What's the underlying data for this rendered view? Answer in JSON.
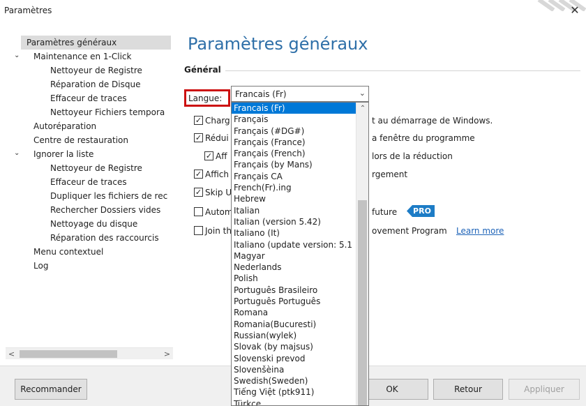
{
  "window": {
    "title": "Paramètres",
    "close_glyph": "✕"
  },
  "sidebar": {
    "items": [
      {
        "label": "Paramètres généraux",
        "selected": true
      },
      {
        "label": "Maintenance en 1-Click",
        "toggle": "expanded"
      },
      {
        "label": "Nettoyeur de Registre"
      },
      {
        "label": "Réparation de Disque"
      },
      {
        "label": "Effaceur de traces"
      },
      {
        "label": "Nettoyeur Fichiers tempora"
      },
      {
        "label": "Autoréparation"
      },
      {
        "label": "Centre de restauration"
      },
      {
        "label": "Ignorer la liste",
        "toggle": "expanded"
      },
      {
        "label": "Nettoyeur de Registre"
      },
      {
        "label": "Effaceur de traces"
      },
      {
        "label": "Dupliquer les fichiers de rec"
      },
      {
        "label": "Rechercher Dossiers vides"
      },
      {
        "label": "Nettoyage du disque"
      },
      {
        "label": "Réparation des raccourcis"
      },
      {
        "label": "Menu contextuel"
      },
      {
        "label": "Log"
      }
    ],
    "scroll_left": "<",
    "scroll_right": ">"
  },
  "main": {
    "title": "Paramètres généraux",
    "group_label": "Général",
    "langue_label": "Langue:",
    "language_selected": "Francais (Fr)",
    "options": [
      {
        "prefix": "Charg",
        "suffix": "t au démarrage de Windows.",
        "checked": true
      },
      {
        "prefix": "Rédui",
        "suffix": "a fenêtre du programme",
        "checked": true
      },
      {
        "prefix": "Aff",
        "suffix": "lors de la réduction",
        "checked": true
      },
      {
        "prefix": "Affich",
        "suffix": "rgement",
        "checked": true
      },
      {
        "prefix": "Skip U",
        "suffix": "",
        "checked": true
      },
      {
        "prefix": "Autom",
        "suffix": "future",
        "checked": false,
        "badge": "PRO"
      },
      {
        "prefix": "Join th",
        "suffix": "ovement Program",
        "checked": false,
        "link": "Learn more"
      }
    ]
  },
  "dropdown": {
    "items": [
      "Francais (Fr)",
      "Français",
      "Français (#DG#)",
      "Français (France)",
      "Français (French)",
      "Français (by Mans)",
      "Français CA",
      "French(Fr).ing",
      "Hebrew",
      "Italian",
      "Italian (version 5.42)",
      "Italiano (It)",
      "Italiano (update version: 5.1",
      "Magyar",
      "Nederlands",
      "Polish",
      "Português Brasileiro",
      "Português Português",
      "Romana",
      "Romania(Bucuresti)",
      "Russian(wylek)",
      "Slovak (by majsus)",
      "Slovenski prevod",
      "Slovenšèina",
      "Swedish(Sweden)",
      "Tiếng Việt (ptk911)",
      "Türkçe"
    ],
    "selected_index": 0
  },
  "footer": {
    "recommend_label": "Recommander",
    "ok_label": "OK",
    "back_label": "Retour",
    "apply_label": "Appliquer"
  },
  "colors": {
    "accent": "#2e6fa8",
    "highlight": "#0078d7",
    "badge": "#1d7cc6",
    "callout": "#cc1010"
  }
}
